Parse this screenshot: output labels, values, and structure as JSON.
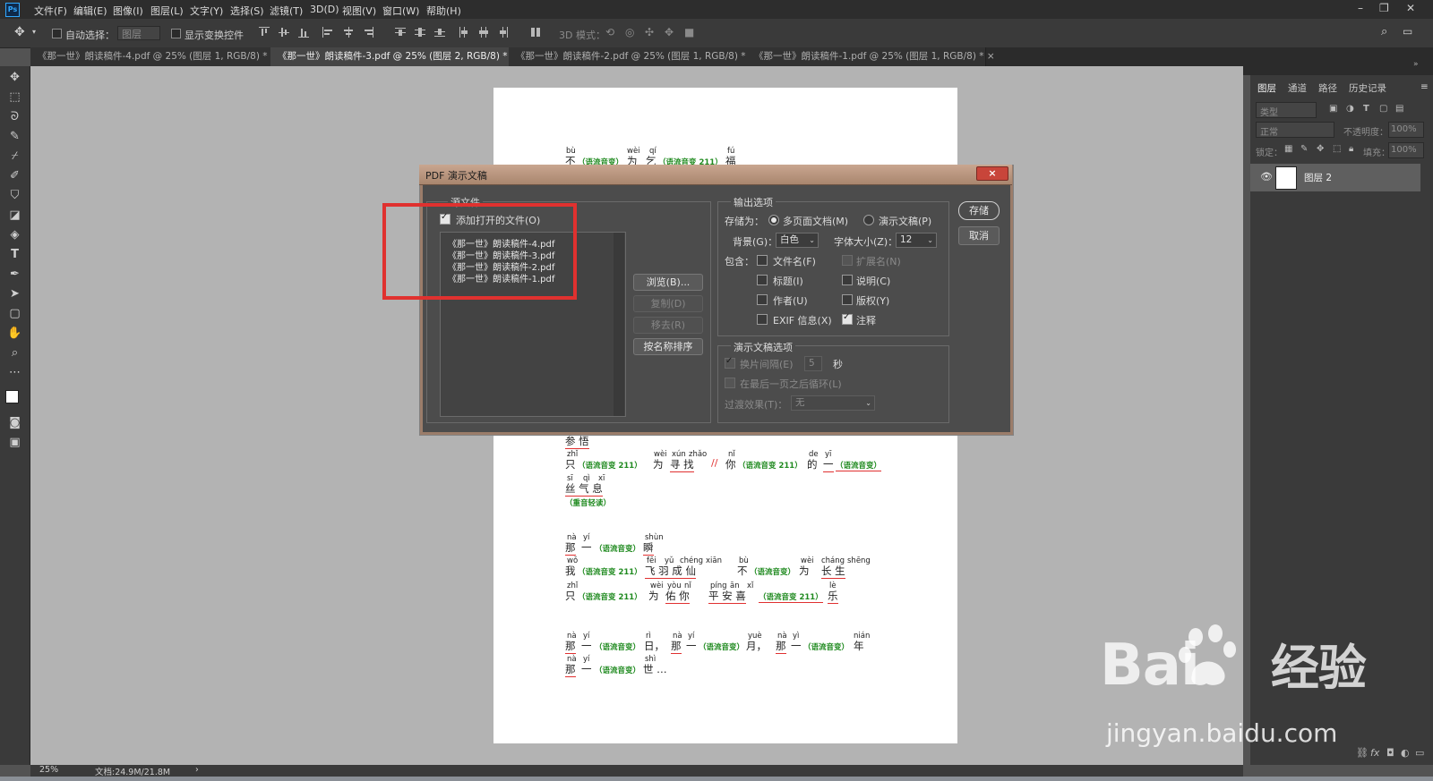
{
  "menubar": {
    "logo": "Ps",
    "items": [
      "文件(F)",
      "编辑(E)",
      "图像(I)",
      "图层(L)",
      "文字(Y)",
      "选择(S)",
      "滤镜(T)",
      "3D(D)",
      "视图(V)",
      "窗口(W)",
      "帮助(H)"
    ]
  },
  "options": {
    "auto_select_label": "自动选择：",
    "auto_select_value": "图层",
    "show_transform_label": "显示变换控件",
    "mode_3d_label": "3D 模式："
  },
  "tabs": [
    "《那一世》朗读稿件-4.pdf @ 25% (图层 1, RGB/8) *",
    "《那一世》朗读稿件-3.pdf @ 25% (图层 2, RGB/8) *",
    "《那一世》朗读稿件-2.pdf @ 25% (图层 1, RGB/8) *",
    "《那一世》朗读稿件-1.pdf @ 25% (图层 1, RGB/8) *"
  ],
  "tab_close": "×",
  "document": {
    "line1": {
      "py": [
        "bù",
        "wèi",
        "qí",
        "fú"
      ],
      "hz": [
        "不",
        "为",
        "乞",
        "福"
      ],
      "notes": [
        "（语流音变）",
        "（语流音变 211）"
      ]
    },
    "line2": {
      "hz": "参 悟"
    },
    "line3": {
      "py": [
        "zhǐ",
        "wèi",
        "xún",
        "zhǎo",
        "nǐ",
        "de",
        "yī"
      ],
      "hz": [
        "只",
        "为",
        "寻 找",
        "你",
        "的",
        "一"
      ],
      "notes": [
        "（语流音变 211）",
        "（语流音变 211）",
        "（语流音变）"
      ],
      "sep": "//"
    },
    "line4": {
      "py": [
        "sī",
        "qì",
        "xī"
      ],
      "hz": "丝 气 息",
      "note": "（重音轻读）"
    },
    "line5": {
      "py": [
        "nà",
        "yí",
        "shùn"
      ],
      "hz": [
        "那",
        "一",
        "瞬"
      ],
      "note": "（语流音变）"
    },
    "line6": {
      "py": [
        "wǒ",
        "fēi",
        "yǔ",
        "chéng",
        "xiān",
        "bù",
        "wèi",
        "cháng",
        "shēng"
      ],
      "hz": [
        "我",
        "飞 羽 成 仙",
        "不",
        "为",
        "长 生"
      ],
      "notes": [
        "（语流音变 211）",
        "（语流音变）"
      ]
    },
    "line7": {
      "py": [
        "zhǐ",
        "wèi",
        "yòu",
        "nǐ",
        "píng",
        "ān",
        "xǐ",
        "lè"
      ],
      "hz": [
        "只",
        "为",
        "佑 你",
        "平 安 喜",
        "乐"
      ],
      "notes": [
        "（语流音变 211）",
        "（语流音变 211）"
      ]
    },
    "line8": {
      "py": [
        "nà",
        "yí",
        "rì",
        "nà",
        "yí",
        "yuè",
        "nà",
        "yì",
        "nián"
      ],
      "hz": [
        "那",
        "一",
        "日，",
        "那",
        "一",
        "月，",
        "那",
        "一",
        "年"
      ],
      "notes": [
        "（语流音变）",
        "（语流音变）",
        "（语流音变）"
      ]
    },
    "line9": {
      "py": [
        "nà",
        "yí",
        "shì"
      ],
      "hz": [
        "那",
        "一",
        "世 …"
      ],
      "note": "（语流音变）"
    }
  },
  "dialog": {
    "title": "PDF 演示文稿",
    "close": "×",
    "source_group": "源文件",
    "add_open_files": "添加打开的文件(O)",
    "files": [
      "《那一世》朗读稿件-4.pdf",
      "《那一世》朗读稿件-3.pdf",
      "《那一世》朗读稿件-2.pdf",
      "《那一世》朗读稿件-1.pdf"
    ],
    "browse": "浏览(B)...",
    "duplicate": "复制(D)",
    "remove": "移去(R)",
    "sort_by_name": "按名称排序",
    "output_group": "输出选项",
    "save_as_label": "存储为：",
    "multipage": "多页面文档(M)",
    "presentation": "演示文稿(P)",
    "background_label": "背景(G)：",
    "background_value": "白色",
    "font_size_label": "字体大小(Z)：",
    "font_size_value": "12",
    "include_label": "包含：",
    "filename": "文件名(F)",
    "extension": "扩展名(N)",
    "title_opt": "标题(I)",
    "description": "说明(C)",
    "author": "作者(U)",
    "copyright": "版权(Y)",
    "exif": "EXIF 信息(X)",
    "notes": "注释",
    "presentation_group": "演示文稿选项",
    "advance_every": "换片间隔(E)",
    "advance_value": "5",
    "seconds": "秒",
    "loop": "在最后一页之后循环(L)",
    "transition_label": "过渡效果(T)：",
    "transition_value": "无",
    "save_btn": "存储",
    "cancel_btn": "取消"
  },
  "panel": {
    "tabs": [
      "图层",
      "通道",
      "路径",
      "历史记录"
    ],
    "kind_label": "类型",
    "blend_mode": "正常",
    "opacity_label": "不透明度：",
    "opacity_value": "100%",
    "lock_label": "锁定：",
    "fill_label": "填充：",
    "fill_value": "100%",
    "layer_name": "图层 2"
  },
  "status": {
    "zoom": "25%",
    "doc_size": "文档:24.9M/21.8M"
  },
  "watermark": {
    "logo_left": "Bai",
    "logo_right": "经验",
    "url": "jingyan.baidu.com"
  },
  "colors": {
    "highlight": "#e0312f",
    "underline": "#e03030",
    "note_green": "#1f8a1f",
    "dialog_title": "#b8957d"
  }
}
